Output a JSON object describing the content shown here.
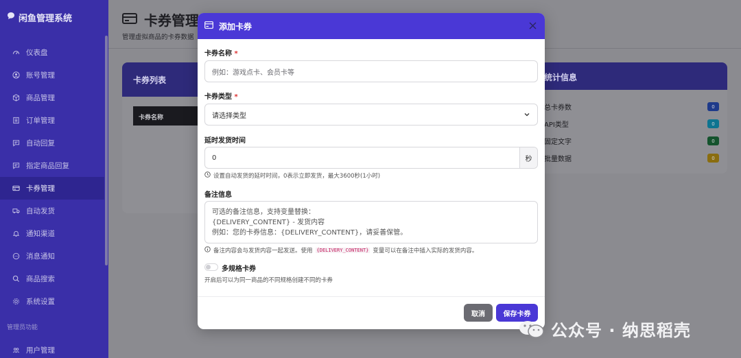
{
  "app": {
    "title": "闲鱼管理系统"
  },
  "sidebar": {
    "items": [
      {
        "label": "仪表盘",
        "icon": "gauge-icon"
      },
      {
        "label": "账号管理",
        "icon": "user-circle-icon"
      },
      {
        "label": "商品管理",
        "icon": "box-icon"
      },
      {
        "label": "订单管理",
        "icon": "list-icon"
      },
      {
        "label": "自动回复",
        "icon": "chat-icon"
      },
      {
        "label": "指定商品回复",
        "icon": "chat-icon"
      },
      {
        "label": "卡券管理",
        "icon": "card-icon",
        "active": true
      },
      {
        "label": "自动发货",
        "icon": "truck-icon"
      },
      {
        "label": "通知渠道",
        "icon": "bell-icon"
      },
      {
        "label": "消息通知",
        "icon": "message-icon"
      },
      {
        "label": "商品搜索",
        "icon": "search-icon"
      },
      {
        "label": "系统设置",
        "icon": "gear-icon"
      }
    ],
    "section_label": "管理员功能",
    "bottom_item": {
      "label": "用户管理",
      "icon": "users-icon"
    }
  },
  "page": {
    "title": "卡券管理",
    "subtitle": "管理虚拟商品的卡券数据"
  },
  "card_list": {
    "title": "卡券列表",
    "column_header": "卡券名称"
  },
  "stats": {
    "title": "统计信息",
    "rows": [
      {
        "label": "总卡券数",
        "value": "0",
        "color": "#1e3a8a"
      },
      {
        "label": "API类型",
        "value": "0",
        "color": "#0e7490"
      },
      {
        "label": "固定文字",
        "value": "0",
        "color": "#14532d"
      },
      {
        "label": "批量数据",
        "value": "0",
        "color": "#8a6d0f"
      }
    ]
  },
  "modal": {
    "title": "添加卡券",
    "name_label": "卡券名称",
    "name_placeholder": "例如：游戏点卡、会员卡等",
    "type_label": "卡券类型",
    "type_selected": "请选择类型",
    "delay_label": "延时发货时间",
    "delay_value": "0",
    "delay_unit": "秒",
    "delay_help": "设置自动发货的延时时间，0表示立即发货，最大3600秒(1小时)",
    "note_label": "备注信息",
    "note_placeholder": "可选的备注信息，支持变量替换：\n{DELIVERY_CONTENT} - 发货内容\n例如：您的卡券信息：{DELIVERY_CONTENT}，请妥善保管。",
    "note_help_pre": "备注内容会与发货内容一起发送。使用",
    "note_help_code": "{DELIVERY_CONTENT}",
    "note_help_post": "变量可以在备注中插入实际的发货内容。",
    "multi_label": "多规格卡券",
    "multi_enabled": false,
    "multi_help": "开启后可以为同一商品的不同规格创建不同的卡券",
    "cancel_label": "取消",
    "save_label": "保存卡券"
  },
  "watermark": {
    "text": "公众号 · 纳思稻壳"
  },
  "colors": {
    "accent": "#4a38d6",
    "sidebar": "#3a2fa8"
  }
}
